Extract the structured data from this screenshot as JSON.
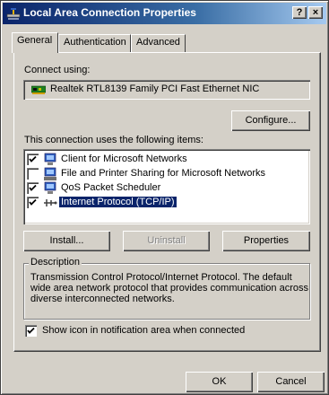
{
  "window": {
    "title": "Local Area Connection Properties",
    "help_button": "?",
    "close_button": "×"
  },
  "tabs": [
    {
      "label": "General"
    },
    {
      "label": "Authentication"
    },
    {
      "label": "Advanced"
    }
  ],
  "connect_using": {
    "label": "Connect using:",
    "adapter": "Realtek RTL8139 Family PCI Fast Ethernet NIC",
    "configure_button": "Configure..."
  },
  "components": {
    "label": "This connection uses the following items:",
    "items": [
      {
        "label": "Client for Microsoft Networks",
        "checked": true,
        "icon": "network-client-icon"
      },
      {
        "label": "File and Printer Sharing for Microsoft Networks",
        "checked": false,
        "icon": "file-printer-sharing-icon"
      },
      {
        "label": "QoS Packet Scheduler",
        "checked": true,
        "icon": "qos-scheduler-icon"
      },
      {
        "label": "Internet Protocol (TCP/IP)",
        "checked": true,
        "icon": "protocol-icon",
        "selected": true
      }
    ],
    "install_button": "Install...",
    "uninstall_button": "Uninstall",
    "properties_button": "Properties"
  },
  "description": {
    "title": "Description",
    "text": "Transmission Control Protocol/Internet Protocol. The default wide area network protocol that provides communication across diverse interconnected networks."
  },
  "show_icon": {
    "label": "Show icon in notification area when connected",
    "checked": true
  },
  "footer": {
    "ok_button": "OK",
    "cancel_button": "Cancel"
  },
  "colors": {
    "dialog_face": "#d4d0c8",
    "title_gradient_start": "#0a246a",
    "title_gradient_end": "#a6caf0",
    "selection": "#0a246a"
  }
}
